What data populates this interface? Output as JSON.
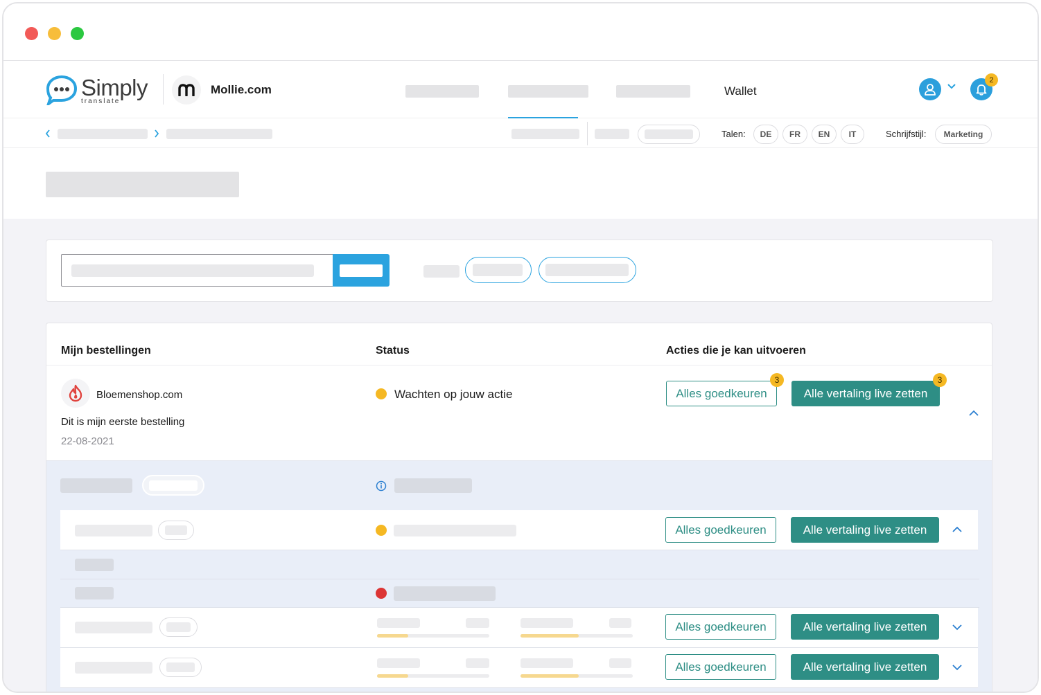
{
  "header": {
    "logo_text": "Simply",
    "logo_subtext": "translate",
    "client_name": "Mollie.com",
    "nav_wallet": "Wallet",
    "notification_count": "2"
  },
  "languages": {
    "label": "Talen:",
    "items": [
      "DE",
      "FR",
      "EN",
      "IT"
    ],
    "style_label": "Schrijfstijl:",
    "style_value": "Marketing"
  },
  "table": {
    "col_orders": "Mijn bestellingen",
    "col_status": "Status",
    "col_actions": "Acties die je kan uitvoeren"
  },
  "order": {
    "shop_name": "Bloemenshop.com",
    "description": "Dit is mijn eerste bestelling",
    "date": "22-08-2021",
    "status": "Wachten op jouw actie",
    "approve_label": "Alles goedkeuren",
    "publish_label": "Alle vertaling live zetten",
    "approve_count": "3",
    "publish_count": "3"
  },
  "subrows": [
    {
      "approve_label": "Alles goedkeuren",
      "publish_label": "Alle vertaling live zetten"
    },
    {
      "approve_label": "Alles goedkeuren",
      "publish_label": "Alle vertaling live zetten"
    },
    {
      "approve_label": "Alles goedkeuren",
      "publish_label": "Alle vertaling live zetten"
    }
  ],
  "colors": {
    "brand_blue": "#2ba3df",
    "teal": "#2e8e85",
    "badge_yellow": "#f5b823",
    "status_red": "#dc3535"
  },
  "icons": [
    "chat-bubble-logo-icon",
    "mollie-m-icon",
    "user-icon",
    "chevron-down-icon",
    "bell-icon",
    "chevron-left-icon",
    "chevron-right-icon",
    "shop-flame-icon",
    "info-icon",
    "chevron-up-icon"
  ]
}
